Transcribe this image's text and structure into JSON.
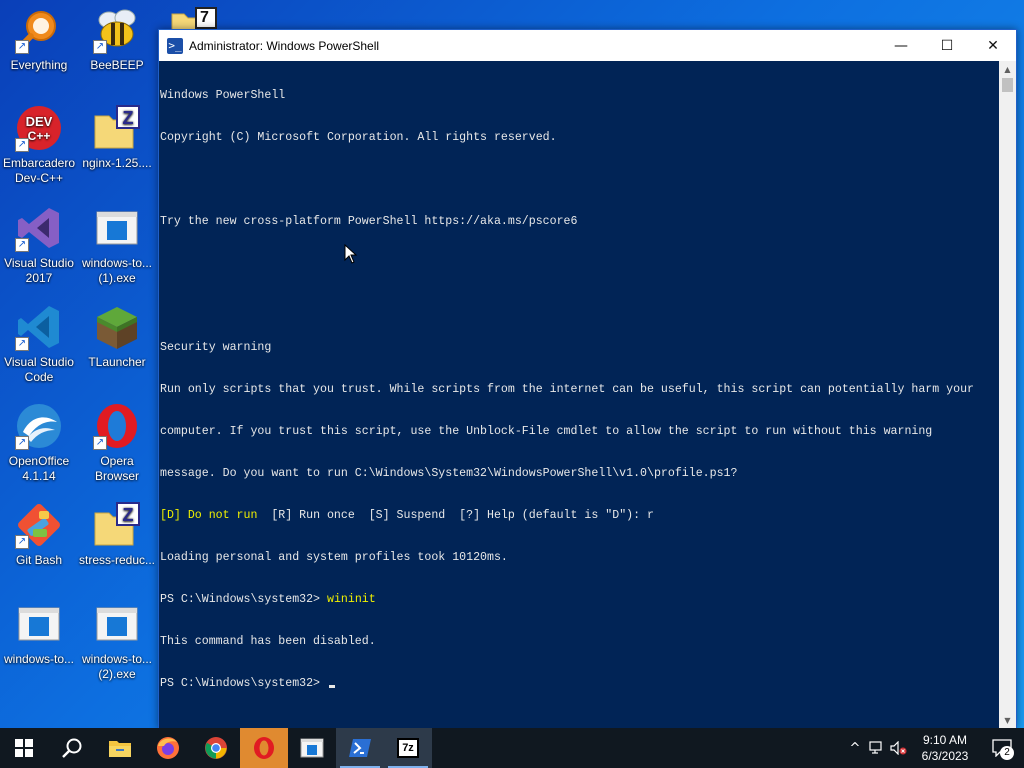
{
  "desktop": {
    "icons": [
      {
        "label": "Everything",
        "glyph": "search-icon"
      },
      {
        "label": "BeeBEEP",
        "glyph": "bee-icon"
      },
      {
        "label": "Embarcadero Dev-C++",
        "glyph": "devcpp-icon"
      },
      {
        "label": "nginx-1.25....",
        "glyph": "zip-folder-icon"
      },
      {
        "label": "Visual Studio 2017",
        "glyph": "visual-studio-icon"
      },
      {
        "label": "windows-to... (1).exe",
        "glyph": "exe-window-icon"
      },
      {
        "label": "Visual Studio Code",
        "glyph": "vscode-icon"
      },
      {
        "label": "TLauncher",
        "glyph": "grass-block-icon"
      },
      {
        "label": "OpenOffice 4.1.14",
        "glyph": "openoffice-icon"
      },
      {
        "label": "Opera Browser",
        "glyph": "opera-icon"
      },
      {
        "label": "Git Bash",
        "glyph": "git-icon"
      },
      {
        "label": "stress-reduc...",
        "glyph": "zip-folder-icon"
      },
      {
        "label": "windows-to...",
        "glyph": "exe-window-icon"
      },
      {
        "label": "windows-to... (2).exe",
        "glyph": "exe-window-icon"
      }
    ],
    "top_folder_badge": "7"
  },
  "window": {
    "title": "Administrator: Windows PowerShell",
    "icon_glyph": ">_",
    "controls": {
      "minimize": "—",
      "maximize": "☐",
      "close": "✕"
    }
  },
  "console": {
    "lines": [
      "Windows PowerShell",
      "Copyright (C) Microsoft Corporation. All rights reserved.",
      "",
      "Try the new cross-platform PowerShell https://aka.ms/pscore6",
      "",
      "",
      "Security warning",
      "Run only scripts that you trust. While scripts from the internet can be useful, this script can potentially harm your",
      "computer. If you trust this script, use the Unblock-File cmdlet to allow the script to run without this warning",
      "message. Do you want to run C:\\Windows\\System32\\WindowsPowerShell\\v1.0\\profile.ps1?"
    ],
    "prompt_choice_default": "[D] Do not run",
    "prompt_choice_rest": "  [R] Run once  [S] Suspend  [?] Help (default is \"D\"): r",
    "after_lines": [
      "Loading personal and system profiles took 10120ms."
    ],
    "prompt1": "PS C:\\Windows\\system32> ",
    "command1": "wininit",
    "output1": "This command has been disabled.",
    "prompt2": "PS C:\\Windows\\system32> "
  },
  "taskbar": {
    "items": [
      {
        "name": "start-button",
        "glyph": "windows-logo-icon"
      },
      {
        "name": "search-button",
        "glyph": "search-icon"
      },
      {
        "name": "file-explorer-button",
        "glyph": "folder-icon"
      },
      {
        "name": "firefox-button",
        "glyph": "firefox-icon"
      },
      {
        "name": "chrome-button",
        "glyph": "chrome-icon"
      },
      {
        "name": "opera-button",
        "glyph": "opera-icon"
      },
      {
        "name": "windows-toolbox-button",
        "glyph": "exe-window-icon"
      },
      {
        "name": "powershell-button",
        "glyph": "powershell-icon"
      },
      {
        "name": "7zip-button",
        "glyph": "7zip-icon"
      }
    ],
    "sevenzip_label": "7z",
    "tray": {
      "chevron": "^",
      "time": "9:10 AM",
      "date": "6/3/2023",
      "notification_count": "2"
    }
  },
  "colors": {
    "console_bg": "#012456",
    "console_text": "#e8e8e8",
    "console_highlight": "#f0f000",
    "taskbar_bg": "#101820"
  }
}
